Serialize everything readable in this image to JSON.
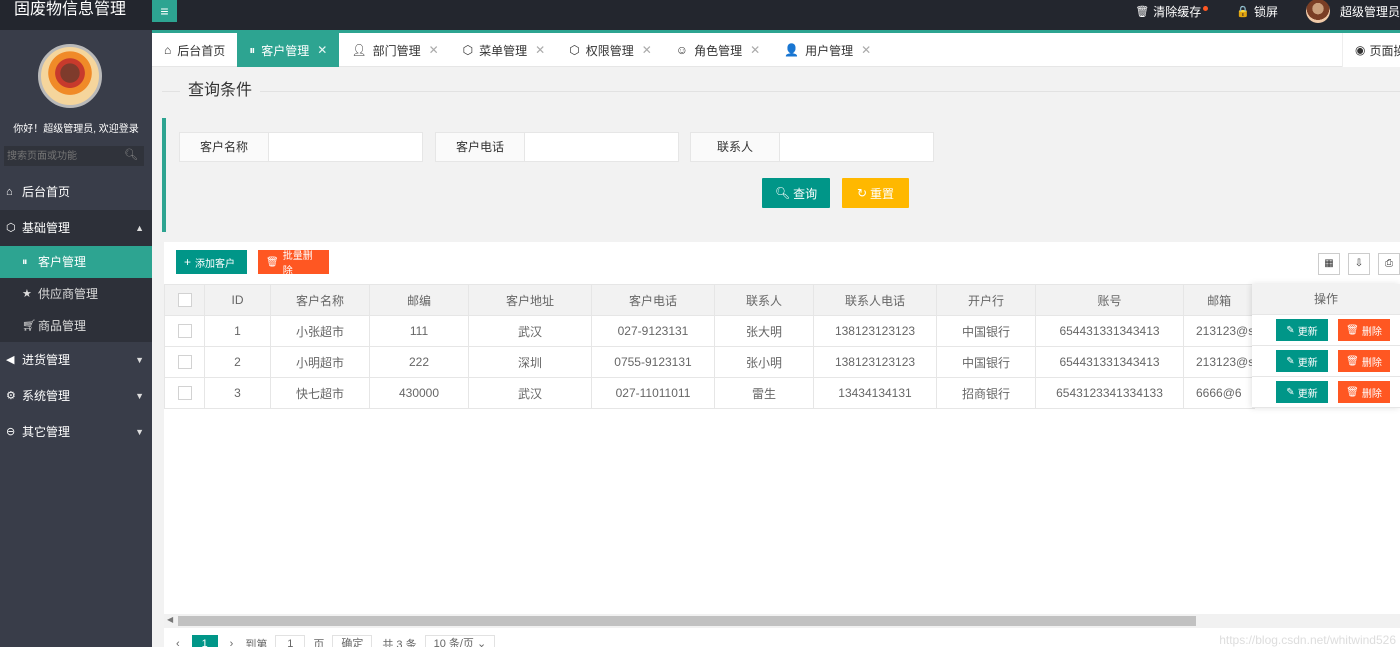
{
  "app": {
    "title": "固废物信息管理"
  },
  "header": {
    "menu_toggle": "≡",
    "clear_cache": "清除缓存",
    "lock_screen": "锁屏",
    "user": "超级管理员"
  },
  "sidebar": {
    "welcome": "你好！超级管理员, 欢迎登录",
    "search_placeholder": "搜索页面或功能",
    "items": [
      {
        "label": "后台首页",
        "icon": "home-icon"
      },
      {
        "label": "基础管理",
        "icon": "cube-icon",
        "open": true,
        "children": [
          {
            "label": "客户管理",
            "icon": "pause-circle-icon",
            "active": true
          },
          {
            "label": "供应商管理",
            "icon": "star-icon"
          },
          {
            "label": "商品管理",
            "icon": "cart-icon"
          }
        ]
      },
      {
        "label": "进货管理",
        "icon": "speaker-icon"
      },
      {
        "label": "系统管理",
        "icon": "gear-icon"
      },
      {
        "label": "其它管理",
        "icon": "circle-arrow-icon"
      }
    ]
  },
  "tabs": [
    {
      "label": "后台首页",
      "icon": "home-icon",
      "closable": false
    },
    {
      "label": "客户管理",
      "icon": "pause-circle-icon",
      "closable": true,
      "active": true
    },
    {
      "label": "部门管理",
      "icon": "user-outline-icon",
      "closable": true
    },
    {
      "label": "菜单管理",
      "icon": "cube-icon",
      "closable": true
    },
    {
      "label": "权限管理",
      "icon": "cube-icon",
      "closable": true
    },
    {
      "label": "角色管理",
      "icon": "smile-icon",
      "closable": true
    },
    {
      "label": "用户管理",
      "icon": "user-icon",
      "closable": true
    }
  ],
  "page_ops": "页面操作",
  "query": {
    "legend": "查询条件",
    "fields": [
      {
        "label": "客户名称",
        "value": ""
      },
      {
        "label": "客户电话",
        "value": ""
      },
      {
        "label": "联系人",
        "value": ""
      }
    ],
    "search_label": "查询",
    "reset_label": "重置"
  },
  "toolbar": {
    "add_label": "添加客户",
    "batch_delete_label": "批量删除"
  },
  "table": {
    "columns": [
      "ID",
      "客户名称",
      "邮编",
      "客户地址",
      "客户电话",
      "联系人",
      "联系人电话",
      "开户行",
      "账号",
      "邮箱"
    ],
    "ops_header": "操作",
    "edit_label": "更新",
    "delete_label": "删除",
    "rows": [
      [
        "1",
        "小张超市",
        "111",
        "武汉",
        "027-9123131",
        "张大明",
        "138123123123",
        "中国银行",
        "654431331343413",
        "213123@s"
      ],
      [
        "2",
        "小明超市",
        "222",
        "深圳",
        "0755-9123131",
        "张小明",
        "138123123123",
        "中国银行",
        "654431331343413",
        "213123@s"
      ],
      [
        "3",
        "快七超市",
        "430000",
        "武汉",
        "027-11011011",
        "雷生",
        "13434134131",
        "招商银行",
        "6543123341334133",
        "6666@6"
      ]
    ]
  },
  "pager": {
    "current": "1",
    "goto_label": "到第",
    "goto_value": "1",
    "page_unit": "页",
    "confirm": "确定",
    "total": "共 3 条",
    "page_size": "10 条/页"
  },
  "watermark": "https://blog.csdn.net/whitwind526"
}
